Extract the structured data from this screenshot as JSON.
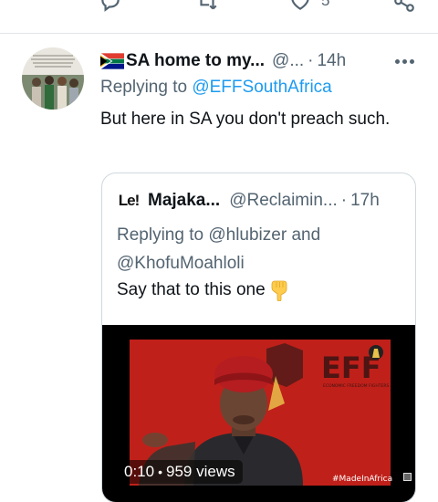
{
  "action_bar": {
    "like_count": "5",
    "icons": [
      "reply-icon",
      "retweet-icon",
      "like-icon",
      "share-icon"
    ]
  },
  "tweet": {
    "flag_icon": "south-africa-flag",
    "display_name": "SA home to my...",
    "handle": "@...",
    "separator": "·",
    "time": "14h",
    "replying_prefix": "Replying to",
    "replying_to": "@EFFSouthAfrica",
    "text": "But here in SA you don't preach such."
  },
  "quote": {
    "avatar_text": "Le!",
    "display_name": "Majaka...",
    "handle": "@Reclaimin...",
    "separator": "·",
    "time": "17h",
    "replying_line": "Replying to @hlubizer and @KhofuMoahloli",
    "text": "Say that to this one",
    "emoji": "backhand-index-pointing-down",
    "video": {
      "duration": "0:10",
      "separator": "•",
      "views": "959 views",
      "watermark": "#MadeInAfrica",
      "backdrop_text": "EFF",
      "backdrop_subtext": "ECONOMIC FREEDOM FIGHTERS"
    }
  },
  "colors": {
    "link": "#1d9bf0",
    "secondary_text": "#536471",
    "primary_text": "#0f1419",
    "border": "#cfd9de",
    "eff_red": "#c8221c"
  }
}
